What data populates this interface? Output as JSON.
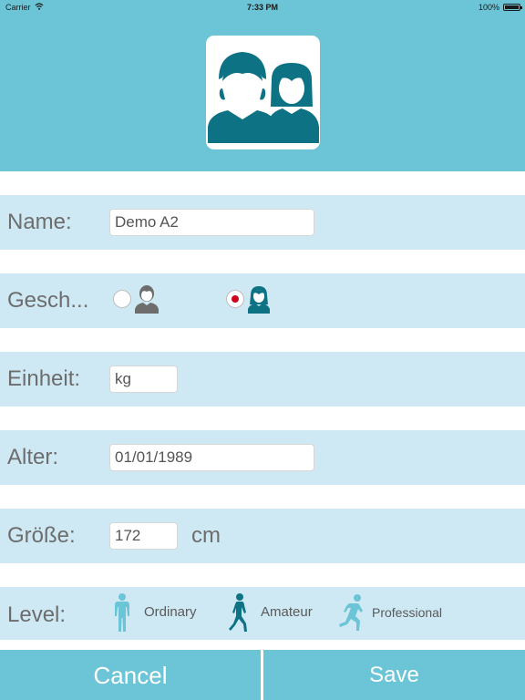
{
  "status_bar": {
    "carrier": "Carrier",
    "time": "7:33 PM",
    "battery": "100%"
  },
  "header": {
    "avatar_icon": "couple-avatar-icon"
  },
  "form": {
    "name": {
      "label": "Name:",
      "value": "Demo A2"
    },
    "gender": {
      "label": "Gesch...",
      "male_icon": "male-user-icon",
      "female_icon": "female-user-icon",
      "selected": "female"
    },
    "unit": {
      "label": "Einheit:",
      "value": "kg"
    },
    "age": {
      "label": "Alter:",
      "value": "01/01/1989"
    },
    "height": {
      "label": "Größe:",
      "value": "172",
      "unit": "cm"
    },
    "level": {
      "label": "Level:",
      "options": [
        {
          "label": "Ordinary",
          "icon": "standing-person-icon"
        },
        {
          "label": "Amateur",
          "icon": "walking-person-icon"
        },
        {
          "label": "Professional",
          "icon": "running-person-icon"
        }
      ]
    }
  },
  "buttons": {
    "cancel": "Cancel",
    "save": "Save"
  },
  "colors": {
    "header_bg": "#6cc4d7",
    "row_bg": "#cfe9f4",
    "icon_teal": "#0d7384",
    "icon_gray": "#6d6d6d",
    "icon_light": "#6cc4d7",
    "radio_selected": "#d0021b"
  }
}
